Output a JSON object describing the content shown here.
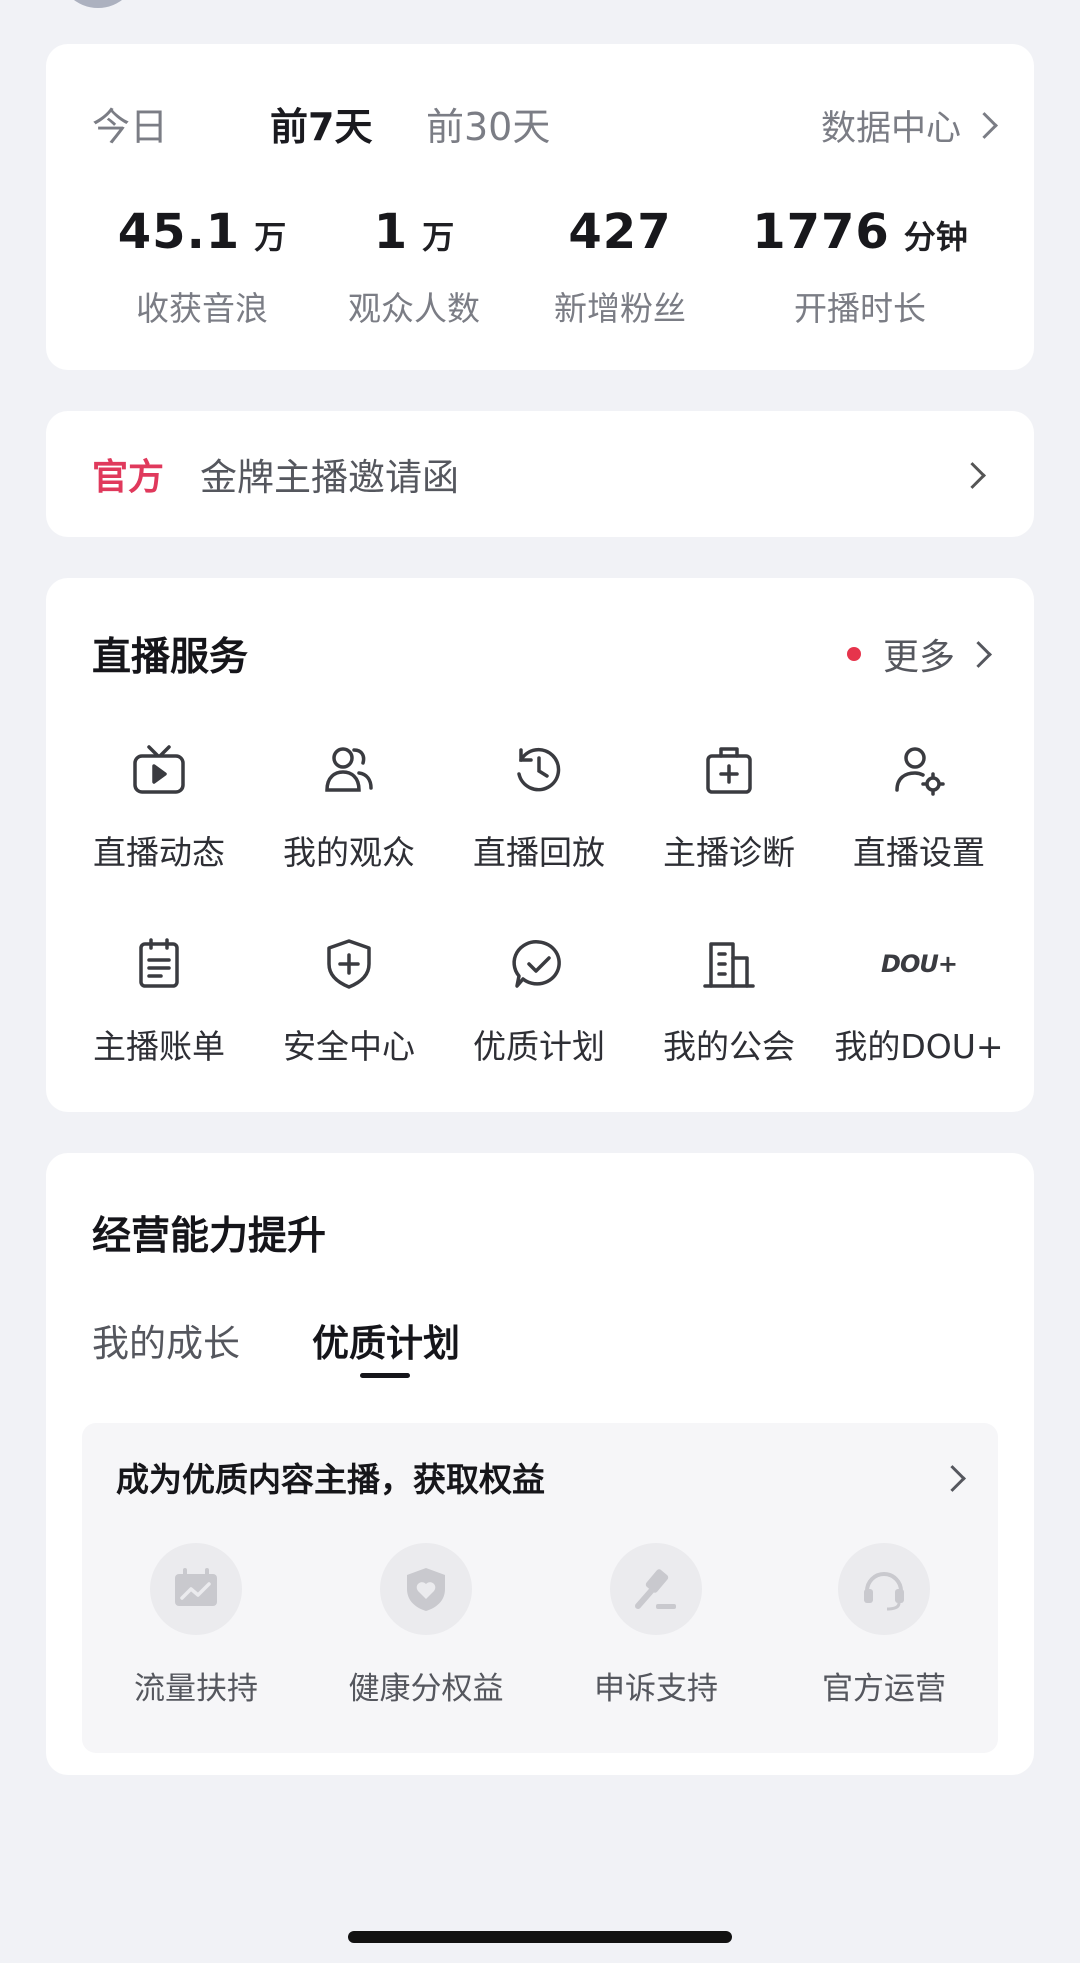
{
  "stats": {
    "range_tabs": [
      "今日",
      "前7天",
      "前30天"
    ],
    "active_tab": "前7天",
    "data_center_label": "数据中心",
    "metrics": [
      {
        "value": "45.1",
        "unit": "万",
        "label": "收获音浪"
      },
      {
        "value": "1",
        "unit": "万",
        "label": "观众人数"
      },
      {
        "value": "427",
        "unit": "",
        "label": "新增粉丝"
      },
      {
        "value": "1776",
        "unit": "分钟",
        "label": "开播时长"
      }
    ]
  },
  "banner": {
    "tag": "官方",
    "text": "金牌主播邀请函"
  },
  "live_service": {
    "title": "直播服务",
    "more_label": "更多",
    "items": [
      {
        "label": "直播动态",
        "icon": "tv-play-icon"
      },
      {
        "label": "我的观众",
        "icon": "users-icon"
      },
      {
        "label": "直播回放",
        "icon": "history-clock-icon"
      },
      {
        "label": "主播诊断",
        "icon": "medical-kit-icon"
      },
      {
        "label": "直播设置",
        "icon": "user-settings-icon"
      },
      {
        "label": "主播账单",
        "icon": "clipboard-icon"
      },
      {
        "label": "安全中心",
        "icon": "shield-plus-icon"
      },
      {
        "label": "优质计划",
        "icon": "check-bubble-icon"
      },
      {
        "label": "我的公会",
        "icon": "building-icon"
      },
      {
        "label": "我的DOU+",
        "icon": "dou-plus-icon",
        "icon_text": "DOU+"
      }
    ]
  },
  "growth": {
    "title": "经营能力提升",
    "tabs": [
      "我的成长",
      "优质计划"
    ],
    "active_tab": "优质计划",
    "card_title": "成为优质内容主播，获取权益",
    "benefits": [
      {
        "label": "流量扶持",
        "icon": "traffic-chart-icon"
      },
      {
        "label": "健康分权益",
        "icon": "shield-heart-icon"
      },
      {
        "label": "申诉支持",
        "icon": "gavel-icon"
      },
      {
        "label": "官方运营",
        "icon": "headset-icon"
      }
    ]
  },
  "colors": {
    "accent_red": "#e0395c",
    "tab_underline_pink": "#f7a7b8",
    "page_bg": "#f1f2f6"
  }
}
